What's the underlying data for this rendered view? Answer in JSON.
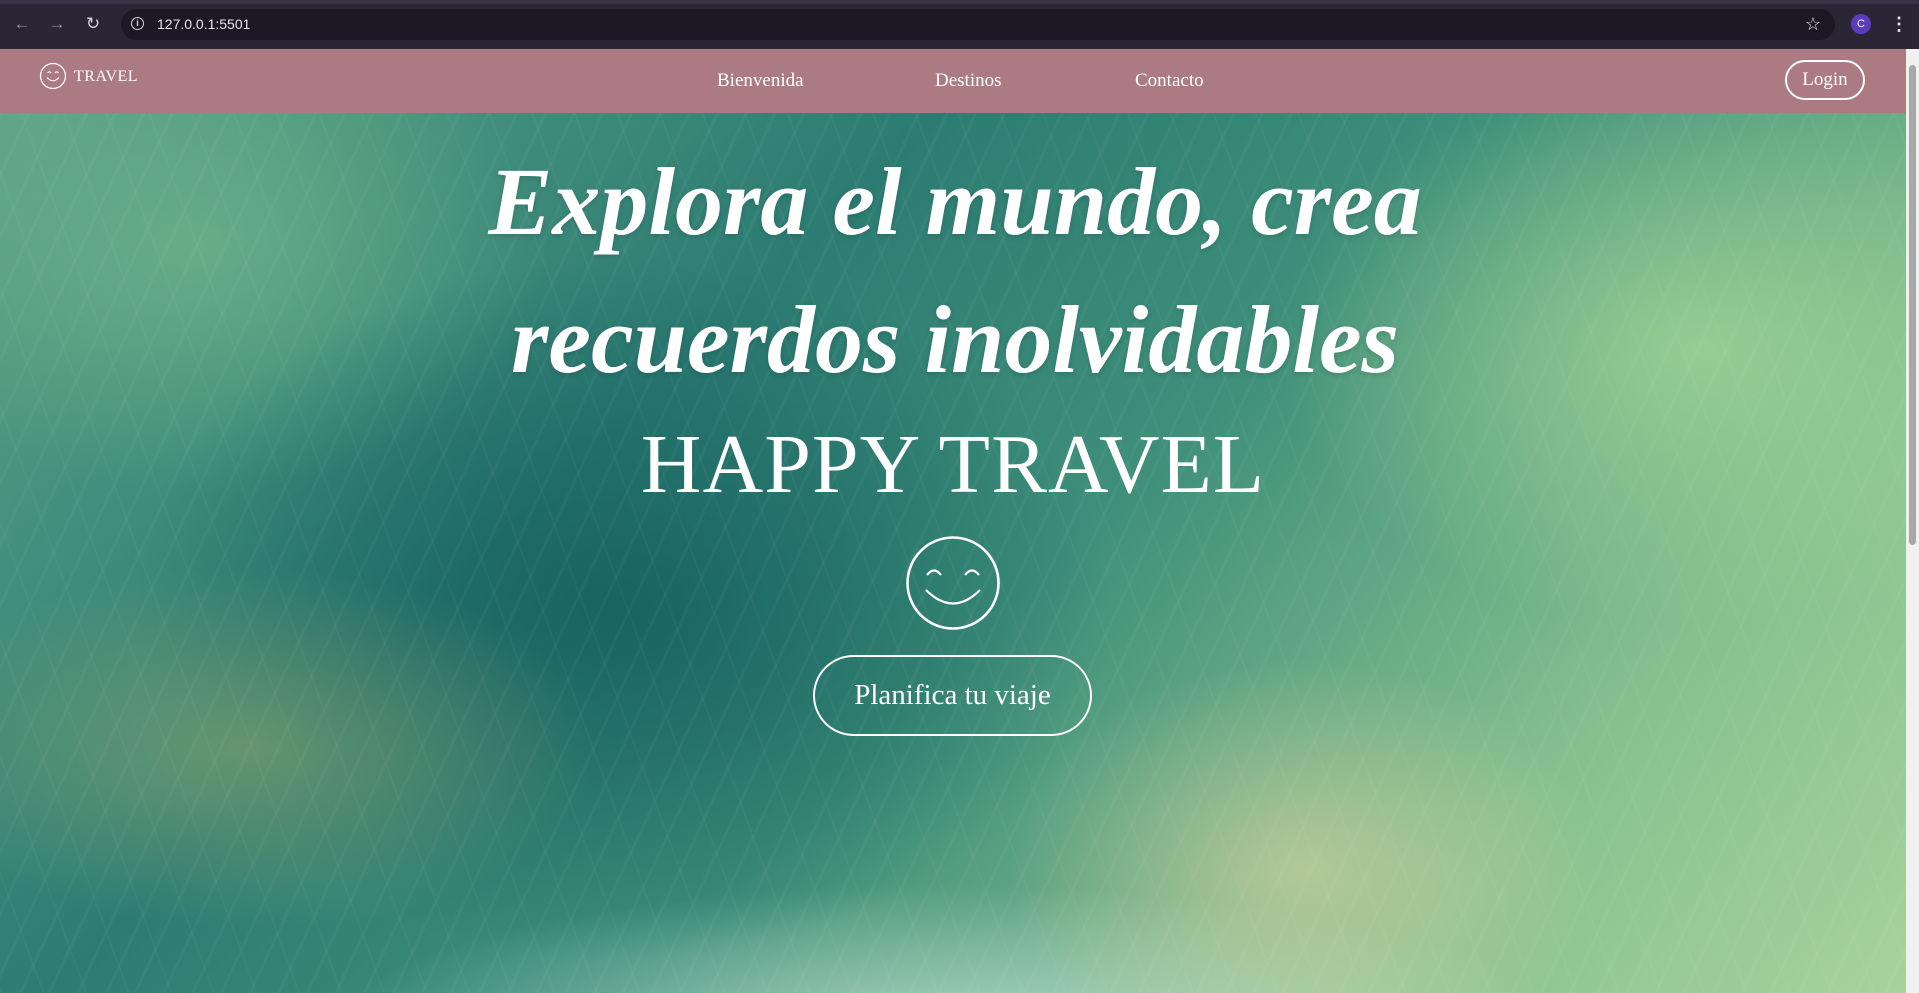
{
  "browser": {
    "url": "127.0.0.1:5501",
    "back_icon": "back-arrow-icon",
    "forward_icon": "forward-arrow-icon",
    "reload_icon": "reload-icon",
    "profile_initial": "C"
  },
  "header": {
    "logo_text": "TRAVEL",
    "nav": [
      {
        "label": "Bienvenida"
      },
      {
        "label": "Destinos"
      },
      {
        "label": "Contacto"
      }
    ],
    "login_label": "Login",
    "background_color": "#ab7a83"
  },
  "hero": {
    "headline_line1": "Explora el mundo, crea",
    "headline_line2": "recuerdos inolvidables",
    "brand": "HAPPY TRAVEL",
    "cta_label": "Planifica tu viaje",
    "icon": "smiley-face-icon"
  }
}
